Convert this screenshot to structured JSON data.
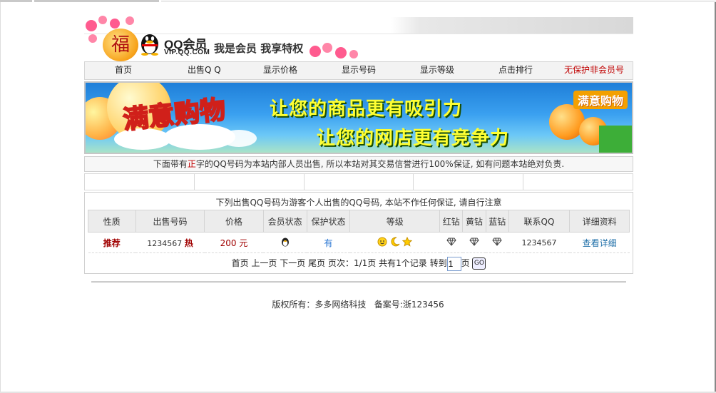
{
  "header": {
    "fu_char": "福",
    "logo_name": "QQ会员",
    "logo_url": "VIP.QQ.COM",
    "slogan": "我是会员 我享特权"
  },
  "nav": {
    "items": [
      {
        "label": "首页"
      },
      {
        "label": "出售Q Q"
      },
      {
        "label": "显示价格"
      },
      {
        "label": "显示号码"
      },
      {
        "label": "显示等级"
      },
      {
        "label": "点击排行"
      },
      {
        "label": "无保护非会员号"
      }
    ]
  },
  "banner": {
    "left_text": "满意购物",
    "line1": "让您的商品更有吸引力",
    "line2": "让您的网店更有竞争力",
    "right_text": "满意购物"
  },
  "notice": {
    "before": "下面带有",
    "highlight": "正",
    "after": "字的QQ号码为本站内部人员出售, 所以本站对其交易信誉进行100%保证, 如有问题本站绝对负责."
  },
  "listing": {
    "title": "下列出售QQ号码为游客个人出售的QQ号码, 本站不作任何保证, 请自行注意",
    "columns": [
      "性质",
      "出售号码",
      "价格",
      "会员状态",
      "保护状态",
      "等级",
      "红钻",
      "黄钻",
      "蓝钻",
      "联系QQ",
      "详细资料"
    ],
    "rows": [
      {
        "type": "推荐",
        "number": "1234567",
        "hot": "热",
        "price": "200 元",
        "member_icon": "penguin-icon",
        "protect": "有",
        "level_icons": [
          "sun-icon",
          "moon-icon",
          "star-icon"
        ],
        "red_diamond": "diamond-icon",
        "yellow_diamond": "diamond-icon",
        "blue_diamond": "diamond-icon",
        "contact_qq": "1234567",
        "detail_link": "查看详细"
      }
    ]
  },
  "pager": {
    "first": "首页",
    "prev": "上一页",
    "next": "下一页",
    "last": "尾页",
    "page_info": "页次：1/1页",
    "total": "共有1个记录",
    "goto_label": "转到",
    "page_value": "1",
    "page_suffix": "页",
    "go": "GO"
  },
  "footer": {
    "copyright": "版权所有：多多网络科技",
    "icp": "备案号:浙123456"
  },
  "colors": {
    "accent_red": "#c00000",
    "link_blue": "#1f6fa8",
    "header_bg": "#ececec"
  }
}
